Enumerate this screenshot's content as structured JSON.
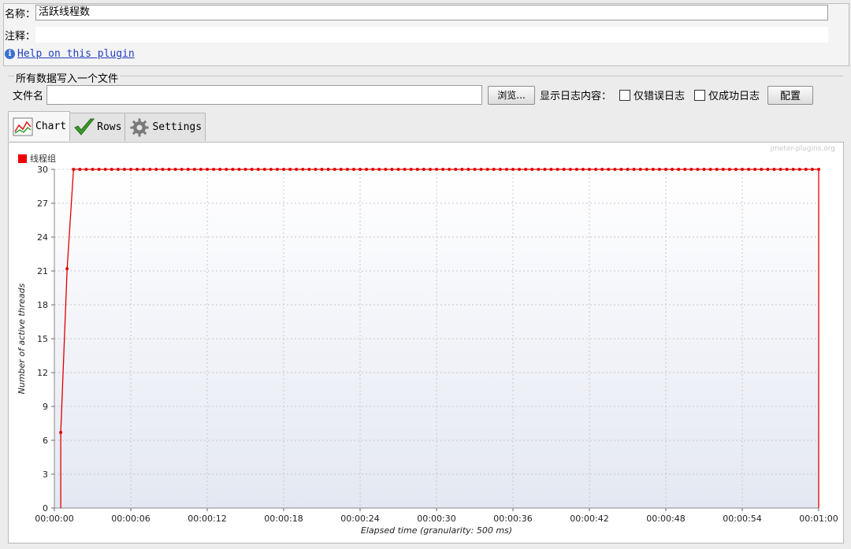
{
  "form": {
    "name_label": "名称：",
    "name_value": "活跃线程数",
    "comment_label": "注释：",
    "comment_value": "",
    "help_link": "Help on this plugin"
  },
  "file_group": {
    "title": "所有数据写入一个文件",
    "filename_label": "文件名",
    "filename_value": "",
    "browse_button": "浏览...",
    "log_label": "显示日志内容：",
    "errors_only_label": "仅错误日志",
    "errors_only_checked": false,
    "success_only_label": "仅成功日志",
    "success_only_checked": false,
    "configure_button": "配置"
  },
  "tabs": [
    {
      "label": "Chart",
      "icon": "chart-icon",
      "active": true
    },
    {
      "label": "Rows",
      "icon": "checkmark-icon",
      "active": false
    },
    {
      "label": "Settings",
      "icon": "gear-icon",
      "active": false
    }
  ],
  "chart": {
    "watermark": "jmeter-plugins.org"
  },
  "chart_data": {
    "type": "line",
    "title": "",
    "xlabel": "Elapsed time (granularity: 500 ms)",
    "ylabel": "Number of active threads",
    "ylim": [
      0,
      30
    ],
    "xlim_seconds": [
      0,
      60
    ],
    "x_tick_labels": [
      "00:00:00",
      "00:00:06",
      "00:00:12",
      "00:00:18",
      "00:00:24",
      "00:00:30",
      "00:00:36",
      "00:00:42",
      "00:00:48",
      "00:00:54",
      "00:01:00"
    ],
    "y_ticks": [
      0,
      3,
      6,
      9,
      12,
      15,
      18,
      21,
      24,
      27,
      30
    ],
    "grid": true,
    "legend_position": "top-left",
    "series": [
      {
        "name": "线程组",
        "color": "#e00000",
        "x_seconds": [
          0.5,
          1.0,
          1.5,
          2.0,
          2.5,
          3.0,
          3.5,
          4.0,
          4.5,
          5.0,
          5.5,
          6.0,
          6.5,
          7.0,
          7.5,
          8.0,
          8.5,
          9.0,
          9.5,
          10.0,
          10.5,
          11.0,
          11.5,
          12.0,
          12.5,
          13.0,
          13.5,
          14.0,
          14.5,
          15.0,
          15.5,
          16.0,
          16.5,
          17.0,
          17.5,
          18.0,
          18.5,
          19.0,
          19.5,
          20.0,
          20.5,
          21.0,
          21.5,
          22.0,
          22.5,
          23.0,
          23.5,
          24.0,
          24.5,
          25.0,
          25.5,
          26.0,
          26.5,
          27.0,
          27.5,
          28.0,
          28.5,
          29.0,
          29.5,
          30.0,
          30.5,
          31.0,
          31.5,
          32.0,
          32.5,
          33.0,
          33.5,
          34.0,
          34.5,
          35.0,
          35.5,
          36.0,
          36.5,
          37.0,
          37.5,
          38.0,
          38.5,
          39.0,
          39.5,
          40.0,
          40.5,
          41.0,
          41.5,
          42.0,
          42.5,
          43.0,
          43.5,
          44.0,
          44.5,
          45.0,
          45.5,
          46.0,
          46.5,
          47.0,
          47.5,
          48.0,
          48.5,
          49.0,
          49.5,
          50.0,
          50.5,
          51.0,
          51.5,
          52.0,
          52.5,
          53.0,
          53.5,
          54.0,
          54.5,
          55.0,
          55.5,
          56.0,
          56.5,
          57.0,
          57.5,
          58.0,
          58.5,
          59.0,
          59.5,
          60.0
        ],
        "values": [
          6.7,
          21.2,
          30,
          30,
          30,
          30,
          30,
          30,
          30,
          30,
          30,
          30,
          30,
          30,
          30,
          30,
          30,
          30,
          30,
          30,
          30,
          30,
          30,
          30,
          30,
          30,
          30,
          30,
          30,
          30,
          30,
          30,
          30,
          30,
          30,
          30,
          30,
          30,
          30,
          30,
          30,
          30,
          30,
          30,
          30,
          30,
          30,
          30,
          30,
          30,
          30,
          30,
          30,
          30,
          30,
          30,
          30,
          30,
          30,
          30,
          30,
          30,
          30,
          30,
          30,
          30,
          30,
          30,
          30,
          30,
          30,
          30,
          30,
          30,
          30,
          30,
          30,
          30,
          30,
          30,
          30,
          30,
          30,
          30,
          30,
          30,
          30,
          30,
          30,
          30,
          30,
          30,
          30,
          30,
          30,
          30,
          30,
          30,
          30,
          30,
          30,
          30,
          30,
          30,
          30,
          30,
          30,
          30,
          30,
          30,
          30,
          30,
          30,
          30,
          30,
          30,
          30,
          30,
          30,
          30
        ],
        "start_value": 0,
        "end_value": 0
      }
    ]
  }
}
